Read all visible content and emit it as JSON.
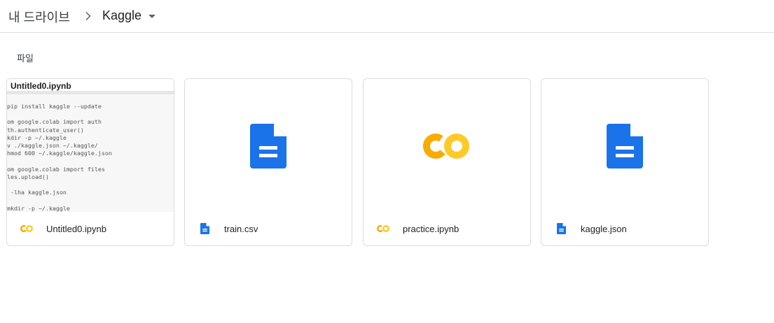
{
  "breadcrumb": {
    "root": "내 드라이브",
    "current": "Kaggle"
  },
  "section": {
    "label": "파일"
  },
  "files": [
    {
      "name": "Untitled0.ipynb",
      "type": "colab",
      "preview_title": "Untitled0.ipynb",
      "preview_code": "pip install kaggle --update\n\nom google.colab import auth\nth.authenticate_user()\nkdir -p ~/.kaggle\nv ./kaggle.json ~/.kaggle/\nhmod 600 ~/.kaggle/kaggle.json\n\nom google.colab import files\nles.upload()\n\n -lha kaggle.json\n\nmkdir -p ~/.kaggle"
    },
    {
      "name": "train.csv",
      "type": "docs"
    },
    {
      "name": "practice.ipynb",
      "type": "colab"
    },
    {
      "name": "kaggle.json",
      "type": "docs"
    }
  ],
  "colors": {
    "docs_blue": "#1a73e8",
    "colab_orange": "#f9ab00",
    "colab_yellow": "#ffca28",
    "border": "#dadce0"
  }
}
